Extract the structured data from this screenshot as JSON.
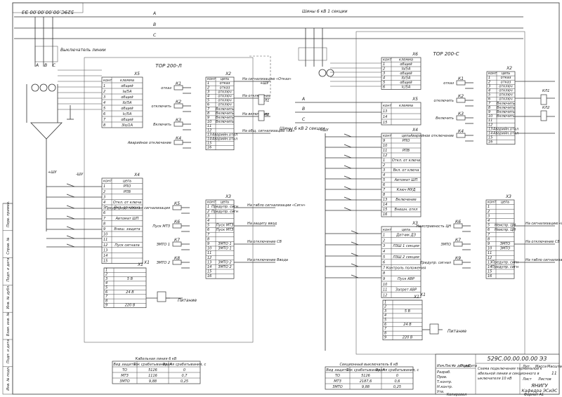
{
  "stamp_code": "529C.00.00.00.00 Э3",
  "busbars": {
    "section1_label": "Шины 6 кВ 1 секции",
    "section2_label": "Шины 6 кВ 2 секции",
    "phases": [
      "А",
      "В",
      "С"
    ]
  },
  "left": {
    "breaker_label": "Выключатель линии",
    "phase_letters": [
      "А",
      "В",
      "С"
    ],
    "device_title": "ТОР 200-Л",
    "x5": {
      "title": "X5",
      "head": [
        "конт",
        "клемма"
      ],
      "rows": [
        [
          "1",
          "общий"
        ],
        [
          "2",
          "Ia/5A"
        ],
        [
          "3",
          "общий"
        ],
        [
          "4",
          "Ib/5A"
        ],
        [
          "5",
          "общий"
        ],
        [
          "6",
          "Ic/5A"
        ],
        [
          "7",
          "общий"
        ],
        [
          "8",
          "3Io/1A"
        ]
      ]
    },
    "x2": {
      "title": "X2",
      "head": [
        "конт",
        "цепь"
      ],
      "rows": [
        [
          "1",
          "отказ"
        ],
        [
          "2",
          "отказ"
        ],
        [
          "3",
          "отключ"
        ],
        [
          "4",
          "отключ"
        ],
        [
          "5",
          "отключ"
        ],
        [
          "6",
          "отключ"
        ],
        [
          "7",
          "Включить"
        ],
        [
          "8",
          "Включить"
        ],
        [
          "9",
          "Включить"
        ],
        [
          "10",
          "Включить"
        ],
        [
          "11",
          ""
        ],
        [
          "12",
          ""
        ],
        [
          "13",
          "Аварийн.откл"
        ],
        [
          "14",
          "Аварийн.откл"
        ],
        [
          "15",
          ""
        ],
        [
          "16",
          ""
        ]
      ]
    },
    "relays_x2": [
      {
        "name": "К1",
        "label": "отказ"
      },
      {
        "name": "К2",
        "label": "отключить"
      },
      {
        "name": "К3",
        "label": "Включить"
      },
      {
        "name": "К4",
        "label": "Аварийное отключение"
      }
    ],
    "x2_outputs": [
      "На сигнализацию «Отказ»",
      "",
      "На отключение",
      "",
      "На включение",
      "",
      "На общ. сигнализацию «Ав»"
    ],
    "x4": {
      "title": "X4",
      "head": [
        "конт",
        "цепь"
      ],
      "rows": [
        [
          "1",
          "РПО"
        ],
        [
          "2",
          "РПВ"
        ],
        [
          "3",
          ""
        ],
        [
          "4",
          "Откл. от ключа"
        ],
        [
          "5",
          "Вкл. от ключа"
        ],
        [
          "6",
          ""
        ],
        [
          "7",
          "Автомат ШП"
        ],
        [
          "8",
          ""
        ],
        [
          "9",
          "Внеш. защита"
        ],
        [
          "10",
          ""
        ],
        [
          "11",
          ""
        ],
        [
          "12",
          "Пуск сигнала"
        ],
        [
          "13",
          ""
        ],
        [
          "14",
          ""
        ],
        [
          "15",
          ""
        ]
      ]
    },
    "x3": {
      "title": "X3",
      "head": [
        "конт",
        "цепь"
      ],
      "rows": [
        [
          "1",
          "Предупр. сигн"
        ],
        [
          "2",
          "Предупр. сигн"
        ],
        [
          "3",
          ""
        ],
        [
          "4",
          ""
        ],
        [
          "5",
          "Пуск МТЗ"
        ],
        [
          "6",
          "Пуск МТЗ"
        ],
        [
          "7",
          ""
        ],
        [
          "8",
          ""
        ],
        [
          "9",
          "ЗМТО 1"
        ],
        [
          "10",
          "ЗМТО 1"
        ],
        [
          "11",
          ""
        ],
        [
          "12",
          ""
        ],
        [
          "13",
          "ЗМТО 2"
        ],
        [
          "14",
          "ЗМТО 2"
        ],
        [
          "15",
          ""
        ],
        [
          "16",
          ""
        ]
      ]
    },
    "relays_x3": [
      {
        "name": "К5",
        "label": "Предупредительная сигнализация"
      },
      {
        "name": "К6",
        "label": "Пуск МТЗ"
      },
      {
        "name": "К7",
        "label": "ЗМТО 1"
      },
      {
        "name": "К8",
        "label": "ЗМТО 2"
      }
    ],
    "x3_outputs": [
      "На табло сигнализации «Сигн»",
      "На защиту ввод",
      "На отключение СВ",
      "На отключение Ввода"
    ],
    "x1": {
      "title": "X1",
      "rows": [
        [
          "1",
          ""
        ],
        [
          "2",
          ""
        ],
        [
          "3",
          "5 В"
        ],
        [
          "4",
          ""
        ],
        [
          "5",
          ""
        ],
        [
          "6",
          "24 В"
        ],
        [
          "7",
          ""
        ],
        [
          "8",
          ""
        ],
        [
          "9",
          "220 В"
        ]
      ]
    },
    "power_label": "Питание",
    "plus_label": "+ШУ",
    "minus_label": "-ШУ",
    "kl_labels": [
      "КЛ1",
      "КЛ2"
    ]
  },
  "right": {
    "device_title": "ТОР 200-С",
    "x6": {
      "title": "X6",
      "head": [
        "конт",
        "клемма"
      ],
      "rows": [
        [
          "1",
          "общий"
        ],
        [
          "2",
          "Ia/5A"
        ],
        [
          "3",
          "общий"
        ],
        [
          "4",
          "Ib/5A"
        ],
        [
          "5",
          "общий"
        ],
        [
          "6",
          "Ic/5A"
        ]
      ]
    },
    "x5": {
      "title": "X5",
      "head": [
        "конт",
        "клемма"
      ],
      "rows": [
        [
          "13",
          ""
        ],
        [
          "14",
          ""
        ],
        [
          "15",
          ""
        ]
      ]
    },
    "x4": {
      "title": "X4",
      "head": [
        "конт",
        "цепь"
      ],
      "rows": [
        [
          "9",
          "РПО"
        ],
        [
          "10",
          ""
        ],
        [
          "11",
          "РПВ"
        ],
        [
          "12",
          ""
        ],
        [
          "1",
          "Откл. от ключа"
        ],
        [
          "2",
          ""
        ],
        [
          "3",
          "Вкл. от ключа"
        ],
        [
          "4",
          ""
        ],
        [
          "5",
          "Автомат ШП"
        ],
        [
          "6",
          ""
        ],
        [
          "7",
          "Ключ МУД"
        ],
        [
          "8",
          ""
        ],
        [
          "13",
          "Включение"
        ],
        [
          "14",
          ""
        ],
        [
          "15",
          "Внешн. откл"
        ],
        [
          "16",
          ""
        ]
      ]
    },
    "x3": {
      "title": "X3",
      "head": [
        "конт",
        "цепь"
      ],
      "rows": [
        [
          "1",
          "Датчик ДЗ"
        ],
        [
          "2",
          ""
        ],
        [
          "3",
          "ЛЗШ 1 секции"
        ],
        [
          "4",
          ""
        ],
        [
          "5",
          "ЛЗШ 2 секции"
        ],
        [
          "6",
          ""
        ],
        [
          "7",
          "Контроль положения"
        ],
        [
          "8",
          ""
        ],
        [
          "9",
          "Пуск АВР"
        ],
        [
          "10",
          ""
        ],
        [
          "11",
          "Запрет АВР"
        ],
        [
          "12",
          ""
        ]
      ]
    },
    "x1": {
      "title": "X1",
      "rows": [
        [
          "1",
          ""
        ],
        [
          "2",
          ""
        ],
        [
          "3",
          "5 В"
        ],
        [
          "4",
          ""
        ],
        [
          "5",
          ""
        ],
        [
          "6",
          "24 В"
        ],
        [
          "7",
          ""
        ],
        [
          "8",
          ""
        ],
        [
          "9",
          "220 В"
        ]
      ]
    },
    "x2": {
      "title": "X2",
      "head": [
        "конт",
        "цепь"
      ],
      "rows": [
        [
          "1",
          "отказ"
        ],
        [
          "2",
          "отказ"
        ],
        [
          "3",
          "отключ"
        ],
        [
          "4",
          "отключ"
        ],
        [
          "5",
          "отключ"
        ],
        [
          "6",
          "отключ"
        ],
        [
          "7",
          "Включить"
        ],
        [
          "8",
          "Включить"
        ],
        [
          "9",
          "Включить"
        ],
        [
          "10",
          "Включить"
        ],
        [
          "11",
          ""
        ],
        [
          "12",
          ""
        ],
        [
          "13",
          "Аварийн.откл"
        ],
        [
          "14",
          "Аварийн.откл"
        ],
        [
          "15",
          ""
        ],
        [
          "16",
          ""
        ]
      ]
    },
    "relays_x2": [
      {
        "name": "К1",
        "label": "отказ"
      },
      {
        "name": "К2",
        "label": "отключить"
      },
      {
        "name": "К3",
        "label": "Включить"
      },
      {
        "name": "К4",
        "label": "Аварийное отключение"
      }
    ],
    "x3b": {
      "title": "X3",
      "head": [
        "конт",
        "цепь"
      ],
      "rows": [
        [
          "1",
          ""
        ],
        [
          "2",
          ""
        ],
        [
          "3",
          ""
        ],
        [
          "4",
          ""
        ],
        [
          "5",
          "Неиспр. ЦН"
        ],
        [
          "6",
          "Неиспр. ЦН"
        ],
        [
          "7",
          ""
        ],
        [
          "8",
          ""
        ],
        [
          "9",
          "ЗМТО"
        ],
        [
          "10",
          "ЗМТО"
        ],
        [
          "11",
          ""
        ],
        [
          "12",
          ""
        ],
        [
          "13",
          "Предупр. сигн"
        ],
        [
          "14",
          "Предупр. сигн"
        ],
        [
          "15",
          ""
        ],
        [
          "16",
          ""
        ]
      ]
    },
    "relays_x3": [
      {
        "name": "К6",
        "label": "Неисправность ЦН"
      },
      {
        "name": "К7",
        "label": "ЗМТО"
      },
      {
        "name": "К9",
        "label": "Предупр. сигнал"
      }
    ],
    "x3_outputs": [
      "На сигнализацию «Неиспр.»",
      "На отключение СВ",
      "На табло сигнализации «Сигн»"
    ],
    "power_label": "Питание",
    "plus_label": "+ШУ",
    "kl_labels": [
      "КЛ1",
      "КЛ2"
    ]
  },
  "tables": {
    "left": {
      "title": "Кабельная линия 6 кВ",
      "headers": [
        "Вид защиты",
        "Ток срабатывания, А",
        "Время срабатывания, с"
      ],
      "rows": [
        [
          "ТО",
          "5126",
          "0"
        ],
        [
          "МТЗ",
          "1116",
          "0,7"
        ],
        [
          "ЗМТО",
          "9,88",
          "0,25"
        ]
      ]
    },
    "right": {
      "title": "Секционный выключатель 6 кВ",
      "headers": [
        "Вид защиты",
        "Ток срабатывания, А",
        "Время срабатывания, с"
      ],
      "rows": [
        [
          "ТО",
          "5126",
          "0"
        ],
        [
          "МТЗ",
          "2187,6",
          "0,6"
        ],
        [
          "ЗМТО",
          "9,88",
          "0,25"
        ]
      ]
    }
  },
  "title_block": {
    "code": "529С.00.00.00.00 Э3",
    "title": "Схема подключения терминалов кабельной линии и секционного выключателя 10 кВ",
    "lit_label": "Лит.",
    "mass_label": "Масса",
    "scale_label": "Масштаб",
    "sheet_label": "Лист",
    "sheets_label": "Листов",
    "sheets_value": "11",
    "org": "ЯНИГУ Кафедра ЭСиЭС",
    "copied": "Копировал",
    "format": "Формат А1",
    "left_col": [
      "Изм.",
      "Лист",
      "№ докум.",
      "Подп.",
      "Дата"
    ],
    "roles": [
      "Разраб.",
      "Пров.",
      "Т.контр.",
      "Н.контр.",
      "Утв."
    ]
  },
  "side_stamp": [
    "Перв. примен.",
    "Справ. №",
    "Подп. и дата",
    "Инв. № дубл.",
    "Взам. инв. №",
    "Подп. и дата",
    "Инв. № подл."
  ]
}
